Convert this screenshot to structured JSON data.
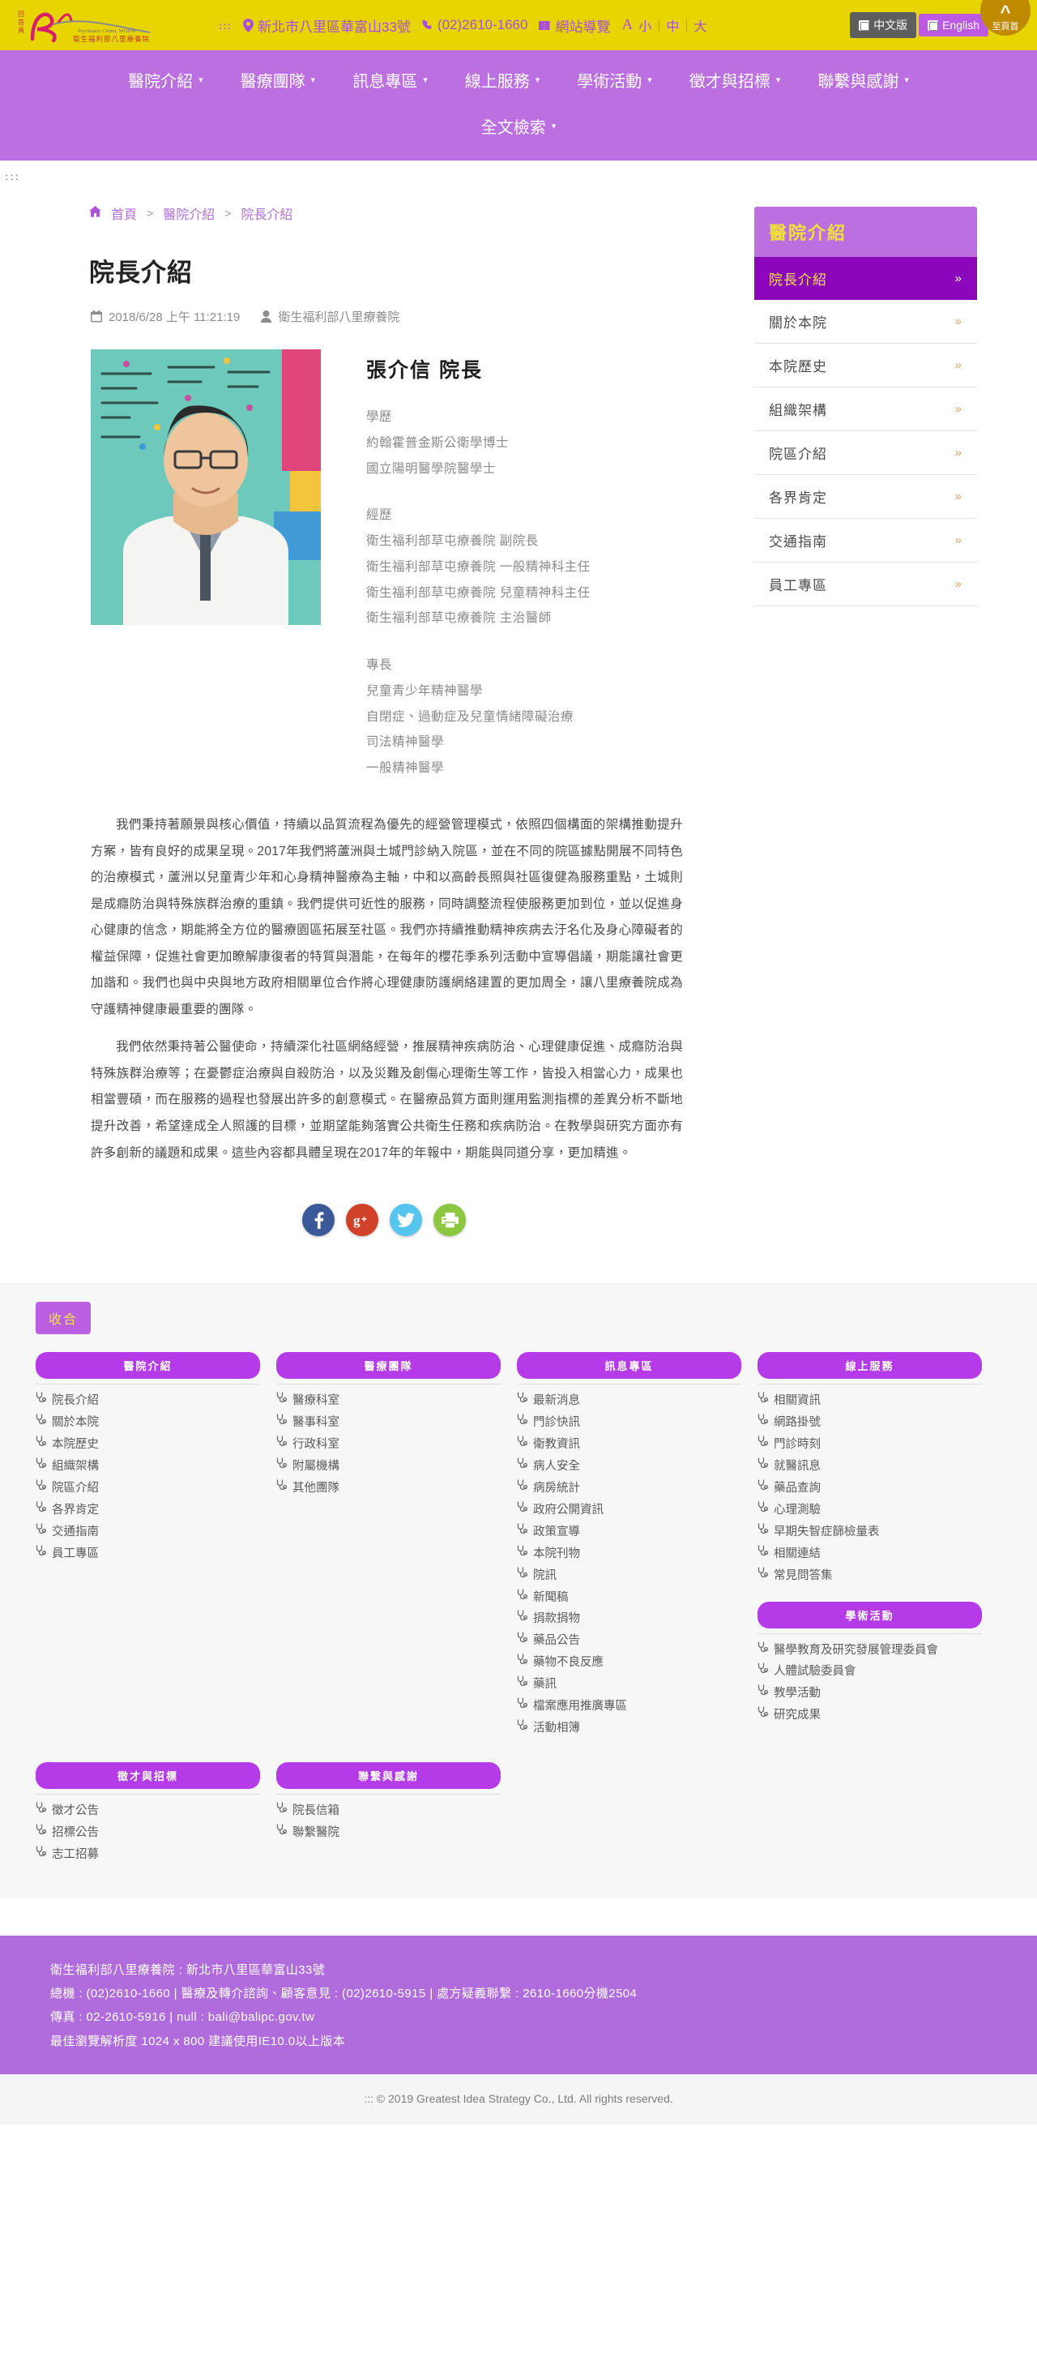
{
  "topbar": {
    "accesskey": ":::",
    "address": "新北市八里區華富山33號",
    "phone": "(02)2610-1660",
    "sitemap": "網站導覽",
    "font_label": "A",
    "font_small": "小",
    "font_medium": "中",
    "font_large": "大",
    "sep": "|",
    "lang_zh": "中文版",
    "lang_en": "English",
    "to_top": "至頁首",
    "logo_sub": "Psychiatric Center, MOHW",
    "logo_cn": "衛生福利部八里療養院",
    "logo_left": "回首頁"
  },
  "nav": {
    "items": [
      "醫院介紹",
      "醫療團隊",
      "訊息專區",
      "線上服務",
      "學術活動",
      "徵才與招標",
      "聯繫與感謝"
    ],
    "search": "全文檢索"
  },
  "breadcrumb": {
    "home": "首頁",
    "sep": ">",
    "items": [
      "醫院介紹",
      "院長介紹"
    ]
  },
  "main": {
    "accesskey": ":::",
    "title": "院長介紹",
    "date": "2018/6/28 上午 11:21:19",
    "author": "衛生福利部八里療養院",
    "doctor_name": "張介信 院長",
    "credentials": [
      "學歷",
      "約翰霍普金斯公衛學博士",
      "國立陽明醫學院醫學士",
      "",
      "經歷",
      "衛生福利部草屯療養院 副院長",
      "衛生福利部草屯療養院 一般精神科主任",
      "衛生福利部草屯療養院 兒童精神科主任",
      "衛生福利部草屯療養院 主治醫師",
      "",
      "專長",
      "兒童青少年精神醫學",
      "自閉症、過動症及兒童情緒障礙治療",
      "司法精神醫學",
      "一般精神醫學"
    ],
    "paragraph1": "我們秉持著願景與核心價值，持續以品質流程為優先的經營管理模式，依照四個構面的架構推動提升方案，皆有良好的成果呈現。2017年我們將蘆洲與土城門診納入院區，並在不同的院區據點開展不同特色的治療模式，蘆洲以兒童青少年和心身精神醫療為主軸，中和以高齡長照與社區復健為服務重點，土城則是成癮防治與特殊族群治療的重鎮。我們提供可近性的服務，同時調整流程使服務更加到位，並以促進身心健康的信念，期能將全方位的醫療園區拓展至社區。我們亦持續推動精神疾病去汙名化及身心障礙者的權益保障，促進社會更加瞭解康復者的特質與潛能，在每年的櫻花季系列活動中宣導倡議，期能讓社會更加諧和。我們也與中央與地方政府相關單位合作將心理健康防護網絡建置的更加周全，讓八里療養院成為守護精神健康最重要的團隊。",
    "paragraph2": "我們依然秉持著公醫使命，持續深化社區網絡經營，推展精神疾病防治、心理健康促進、成癮防治與特殊族群治療等；在憂鬱症治療與自殺防治，以及災難及創傷心理衛生等工作，皆投入相當心力，成果也相當豐碩，而在服務的過程也發展出許多的創意模式。在醫療品質方面則運用監測指標的差異分析不斷地提升改善，希望達成全人照護的目標，並期望能夠落實公共衛生任務和疾病防治。在教學與研究方面亦有許多創新的議題和成果。這些內容都具體呈現在2017年的年報中，期能與同道分享，更加精進。",
    "share": {
      "facebook": "f",
      "google": "g+",
      "twitter": "t",
      "print": "p"
    }
  },
  "sidemenu": {
    "title": "醫院介紹",
    "items": [
      {
        "label": "院長介紹",
        "active": true
      },
      {
        "label": "關於本院",
        "active": false
      },
      {
        "label": "本院歷史",
        "active": false
      },
      {
        "label": "組織架構",
        "active": false
      },
      {
        "label": "院區介紹",
        "active": false
      },
      {
        "label": "各界肯定",
        "active": false
      },
      {
        "label": "交通指南",
        "active": false
      },
      {
        "label": "員工專區",
        "active": false
      }
    ],
    "arrow": "»"
  },
  "sitemap": {
    "collapse": "收合",
    "columns": [
      {
        "head": "醫院介紹",
        "links": [
          "院長介紹",
          "關於本院",
          "本院歷史",
          "組織架構",
          "院區介紹",
          "各界肯定",
          "交通指南",
          "員工專區"
        ]
      },
      {
        "head": "醫療團隊",
        "links": [
          "醫療科室",
          "醫事科室",
          "行政科室",
          "附屬機構",
          "其他團隊"
        ]
      },
      {
        "head": "訊息專區",
        "links": [
          "最新消息",
          "門診快訊",
          "衛教資訊",
          "病人安全",
          "病房統計",
          "政府公開資訊",
          "政策宣導",
          "本院刊物",
          "院訊",
          "新聞稿",
          "捐款捐物",
          "藥品公告",
          "藥物不良反應",
          "藥訊",
          "檔案應用推廣專區",
          "活動相簿"
        ]
      },
      {
        "head": "線上服務",
        "links": [
          "相關資訊",
          "網路掛號",
          "門診時刻",
          "就醫訊息",
          "藥品查詢",
          "心理測驗",
          "早期失智症篩檢量表",
          "相關連結",
          "常見問答集"
        ],
        "head2": "學術活動",
        "links2": [
          "醫學教育及研究發展管理委員會",
          "人體試驗委員會",
          "教學活動",
          "研究成果"
        ]
      }
    ],
    "columns_row2": [
      {
        "head": "徵才與招標",
        "links": [
          "徵才公告",
          "招標公告",
          "志工招募"
        ]
      },
      {
        "head": "聯繫與感謝",
        "links": [
          "院長信箱",
          "聯繫醫院"
        ]
      }
    ]
  },
  "footer": {
    "line1": "衛生福利部八里療養院 : 新北市八里區華富山33號",
    "line2": "總機 : (02)2610-1660 | 醫療及轉介諮詢、顧客意見 : (02)2610-5915 | 處方疑義聯繫 : 2610-1660分機2504",
    "line3": "傳真 : 02-2610-5916 | null : bali@balipc.gov.tw",
    "line4": "最佳瀏覽解析度 1024 x 800 建議使用IE10.0以上版本",
    "copyright": "::: © 2019 Greatest Idea Strategy Co., Ltd. All rights reserved."
  }
}
